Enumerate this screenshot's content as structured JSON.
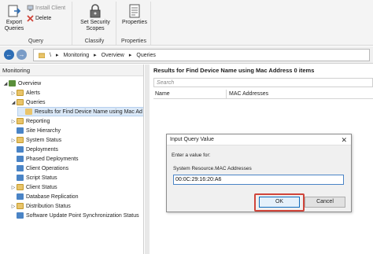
{
  "ribbon": {
    "export_queries": "Export Queries",
    "install_client": "Install Client",
    "delete": "Delete",
    "query_group": "Query",
    "set_security_scopes": "Set Security Scopes",
    "classify_group": "Classify",
    "properties": "Properties",
    "properties_group": "Properties"
  },
  "address": {
    "back": "←",
    "forward": "→",
    "crumbs": [
      "\\",
      "▸",
      "Monitoring",
      "▸",
      "Overview",
      "▸",
      "Queries"
    ]
  },
  "left": {
    "header": "Monitoring",
    "items": [
      {
        "label": "Overview",
        "caret": "◢",
        "indent": 0,
        "icon": "overview-icon"
      },
      {
        "label": "Alerts",
        "caret": "▷",
        "indent": 1,
        "icon": "folder-icon"
      },
      {
        "label": "Queries",
        "caret": "◢",
        "indent": 1,
        "icon": "folder-icon"
      },
      {
        "label": "Results for Find Device Name using Mac Ad",
        "caret": "",
        "indent": 2,
        "icon": "query-icon",
        "selected": true
      },
      {
        "label": "Reporting",
        "caret": "▷",
        "indent": 1,
        "icon": "folder-icon"
      },
      {
        "label": "Site Hierarchy",
        "caret": "",
        "indent": 1,
        "icon": "hierarchy-icon"
      },
      {
        "label": "System Status",
        "caret": "▷",
        "indent": 1,
        "icon": "folder-icon"
      },
      {
        "label": "Deployments",
        "caret": "",
        "indent": 1,
        "icon": "deployments-icon"
      },
      {
        "label": "Phased Deployments",
        "caret": "",
        "indent": 1,
        "icon": "phased-icon"
      },
      {
        "label": "Client Operations",
        "caret": "",
        "indent": 1,
        "icon": "client-ops-icon"
      },
      {
        "label": "Script Status",
        "caret": "",
        "indent": 1,
        "icon": "script-icon"
      },
      {
        "label": "Client Status",
        "caret": "▷",
        "indent": 1,
        "icon": "folder-icon"
      },
      {
        "label": "Database Replication",
        "caret": "",
        "indent": 1,
        "icon": "database-icon"
      },
      {
        "label": "Distribution Status",
        "caret": "▷",
        "indent": 1,
        "icon": "folder-icon"
      },
      {
        "label": "Software Update Point Synchronization Status",
        "caret": "",
        "indent": 1,
        "icon": "sync-icon"
      }
    ]
  },
  "right": {
    "title": "Results for Find Device Name using Mac Address 0 items",
    "search_placeholder": "Search",
    "columns": [
      "Name",
      "MAC Addresses"
    ]
  },
  "dialog": {
    "title": "Input Query Value",
    "close": "✕",
    "prompt": "Enter a value for:",
    "field_label": "System Resource.MAC Addresses",
    "value": "00:0C:29:16:20:A6",
    "ok": "OK",
    "cancel": "Cancel"
  },
  "colors": {
    "accent": "#2d6db5",
    "highlight": "#d0453a",
    "folder": "#e9c46a"
  }
}
